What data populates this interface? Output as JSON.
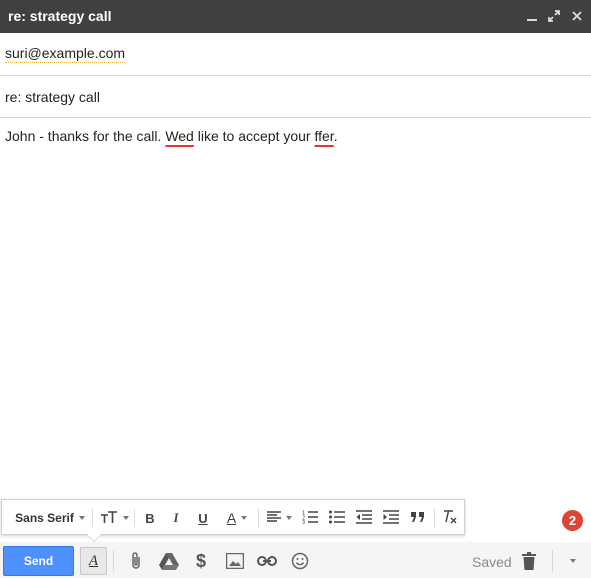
{
  "window": {
    "title": "re: strategy call",
    "minimize_icon": "minimize-icon",
    "expand_icon": "expand-icon",
    "close_icon": "close-icon"
  },
  "compose": {
    "to": "suri@example.com",
    "subject": "re: strategy call",
    "body": {
      "part1": "John - thanks for the call. ",
      "misspelled1": "Wed",
      "part2": " like to accept your ",
      "misspelled2": "ffer",
      "part3": "."
    }
  },
  "formatting_toolbar": {
    "font": "Sans Serif",
    "tools": [
      "font-size",
      "bold",
      "italic",
      "underline",
      "text-color",
      "align",
      "numbered-list",
      "bulleted-list",
      "indent-less",
      "indent-more",
      "quote",
      "remove-formatting"
    ],
    "bold_label": "B",
    "italic_label": "I",
    "underline_label": "U",
    "text_color_label": "A"
  },
  "notification_badge": "2",
  "bottom_bar": {
    "send_label": "Send",
    "formatting_label": "A",
    "status": "Saved",
    "icons": [
      "attach-icon",
      "drive-icon",
      "money-icon",
      "photo-icon",
      "link-icon",
      "emoji-icon",
      "trash-icon",
      "more-options-icon"
    ]
  },
  "colors": {
    "titlebar": "#404040",
    "send_button": "#4d90fe",
    "badge": "#db4437",
    "spellcheck": "#e03a3a"
  }
}
